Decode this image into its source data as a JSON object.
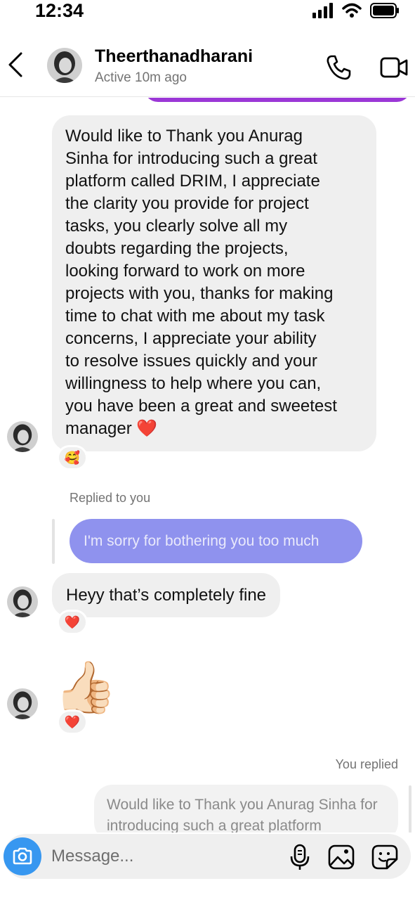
{
  "status_bar": {
    "time": "12:34"
  },
  "header": {
    "name": "Theerthanadharani",
    "status": "Active 10m ago"
  },
  "messages": {
    "long_message": "Would like to Thank you Anurag\nSinha for introducing such a great\nplatform called DRIM, I appreciate\nthe clarity you provide for project\ntasks,  you clearly solve all my\ndoubts regarding the projects,\nlooking forward to work on more\nprojects with you, thanks for making\ntime to chat with me about my task\nconcerns, I appreciate your ability\nto resolve issues quickly and your\nwillingness to help where you can,\nyou have been a great and sweetest\nmanager ❤️",
    "long_message_reaction": "🥰",
    "replied_label": "Replied to you",
    "quoted_text": "I'm sorry for bothering you too much",
    "short_message": "Heyy that’s completely fine",
    "short_message_reaction": "❤️",
    "thumbs_emoji": "👍🏻",
    "thumbs_reaction": "❤️",
    "you_replied_label": "You replied",
    "my_quoted_text": "Would like to Thank you Anurag Sinha for introducing such a great platform"
  },
  "composer": {
    "placeholder": "Message..."
  },
  "icons": {
    "back": "chevron-left-icon",
    "call": "phone-icon",
    "video": "video-camera-icon",
    "camera": "camera-icon",
    "mic": "microphone-icon",
    "gallery": "image-icon",
    "sticker": "sticker-icon"
  },
  "colors": {
    "accent": "#3797f0",
    "sent_bubble": "#8f92ee",
    "received_bubble": "#efefef",
    "purple_strip": "#9b37d6"
  }
}
